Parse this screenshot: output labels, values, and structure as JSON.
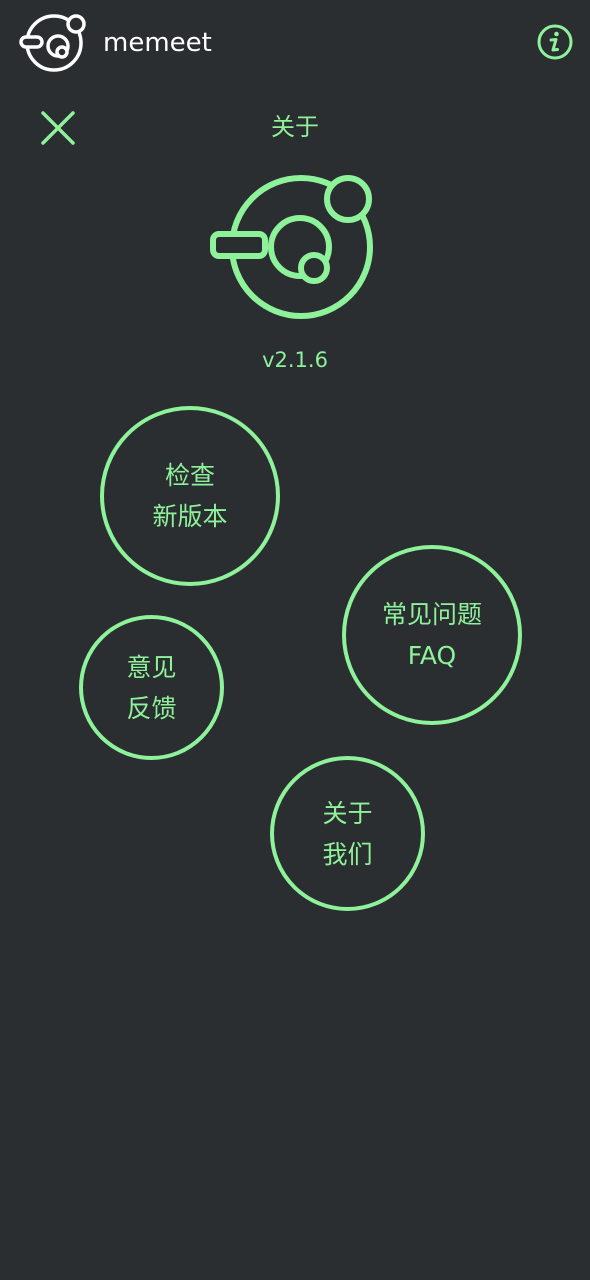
{
  "app": {
    "name": "memeet",
    "logo_icon": "planet-logo-icon",
    "info_icon": "info-icon"
  },
  "header": {
    "title": "关于",
    "close_icon": "close-icon"
  },
  "about": {
    "logo_icon": "planet-logo-icon",
    "version": "v2.1.6"
  },
  "actions": {
    "check_update": [
      "检查",
      "新版本"
    ],
    "faq": [
      "常见问题",
      "FAQ"
    ],
    "feedback": [
      "意见",
      "反馈"
    ],
    "about_us": [
      "关于",
      "我们"
    ]
  },
  "colors": {
    "background": "#2b2e31",
    "accent": "#8ef29a",
    "topbar_text": "#ffffff"
  }
}
